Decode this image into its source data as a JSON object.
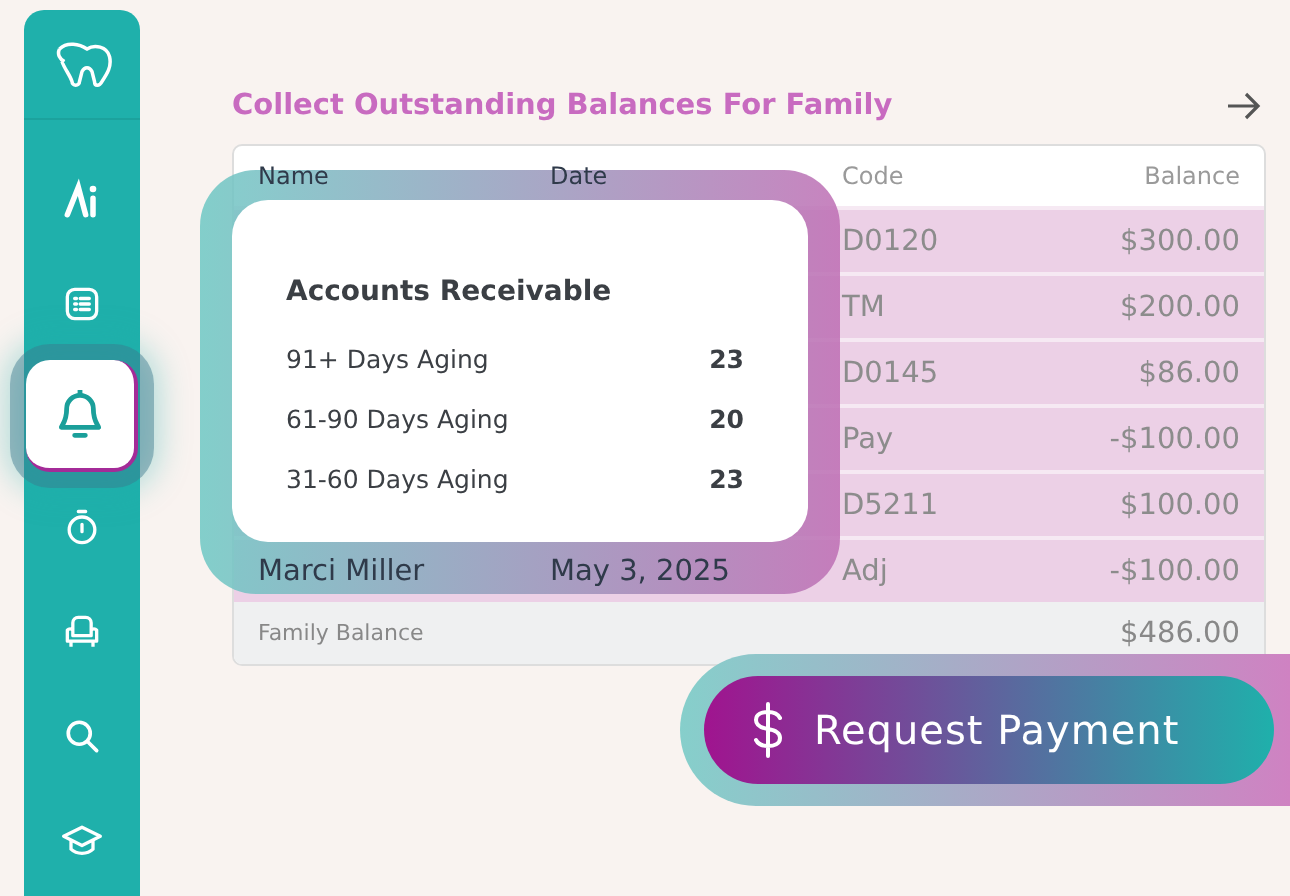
{
  "sidebar": {
    "items": [
      {
        "selected": false
      },
      {
        "selected": false
      },
      {
        "selected": false
      },
      {
        "selected": true
      },
      {
        "selected": false
      },
      {
        "selected": false
      },
      {
        "selected": false
      },
      {
        "selected": false
      }
    ]
  },
  "panel": {
    "title": "Collect Outstanding Balances For Family"
  },
  "table": {
    "columns": [
      "Name",
      "Date",
      "Code",
      "Balance"
    ],
    "rows": [
      {
        "code": "D0120",
        "balance": "$300.00"
      },
      {
        "code": "TM",
        "balance": "$200.00"
      },
      {
        "code": "D0145",
        "balance": "$86.00"
      },
      {
        "code": "Pay",
        "balance": "-$100.00"
      },
      {
        "code": "D5211",
        "balance": "$100.00"
      },
      {
        "name": "Marci Miller",
        "date": "May 3, 2025",
        "code": "Adj",
        "balance": "-$100.00"
      }
    ],
    "footer": {
      "label": "Family Balance",
      "balance": "$486.00"
    }
  },
  "popup": {
    "title": "Accounts Receivable",
    "rows": [
      {
        "label": "91+ Days Aging",
        "count": "23"
      },
      {
        "label": "61-90 Days Aging",
        "count": "20"
      },
      {
        "label": "31-60 Days Aging",
        "count": "23"
      }
    ]
  },
  "button": {
    "label": "Request Payment"
  }
}
